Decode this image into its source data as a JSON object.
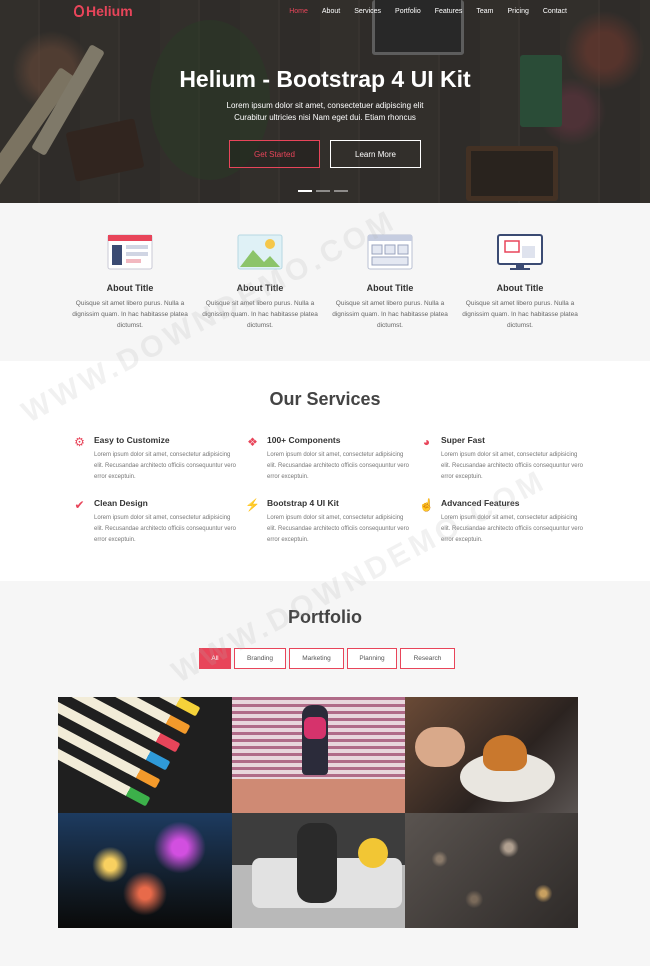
{
  "brand": {
    "name": "Helium",
    "accent": "#e8455a"
  },
  "nav": {
    "items": [
      "Home",
      "About",
      "Services",
      "Portfolio",
      "Features",
      "Team",
      "Pricing",
      "Contact"
    ],
    "active": "Home"
  },
  "hero": {
    "title": "Helium - Bootstrap 4 UI Kit",
    "subtitle": "Lorem ipsum dolor sit amet, consectetuer adipiscing elit Curabitur ultricies nisi Nam eget dui. Etiam rhoncus",
    "primary_button": "Get Started",
    "secondary_button": "Learn More",
    "slides": 3,
    "active_slide": 1
  },
  "features": [
    {
      "icon": "dashboard-icon",
      "title": "About Title",
      "text": "Quisque sit amet libero purus. Nulla a dignissim quam. In hac habitasse platea dictumst."
    },
    {
      "icon": "image-icon",
      "title": "About Title",
      "text": "Quisque sit amet libero purus. Nulla a dignissim quam. In hac habitasse platea dictumst."
    },
    {
      "icon": "layout-icon",
      "title": "About Title",
      "text": "Quisque sit amet libero purus. Nulla a dignissim quam. In hac habitasse platea dictumst."
    },
    {
      "icon": "monitor-icon",
      "title": "About Title",
      "text": "Quisque sit amet libero purus. Nulla a dignissim quam. In hac habitasse platea dictumst."
    }
  ],
  "services": {
    "title": "Our Services",
    "items": [
      {
        "icon": "gears-icon",
        "title": "Easy to Customize",
        "text": "Lorem ipsum dolor sit amet, consectetur adipisicing elit. Recusandae architecto officiis consequuntur vero error exceptuin."
      },
      {
        "icon": "cubes-icon",
        "title": "100+ Components",
        "text": "Lorem ipsum dolor sit amet, consectetur adipisicing elit. Recusandae architecto officiis consequuntur vero error exceptuin."
      },
      {
        "icon": "speedometer-icon",
        "title": "Super Fast",
        "text": "Lorem ipsum dolor sit amet, consectetur adipisicing elit. Recusandae architecto officiis consequuntur vero error exceptuin."
      },
      {
        "icon": "check-icon",
        "title": "Clean Design",
        "text": "Lorem ipsum dolor sit amet, consectetur adipisicing elit. Recusandae architecto officiis consequuntur vero error exceptuin."
      },
      {
        "icon": "bolt-icon",
        "title": "Bootstrap 4 UI Kit",
        "text": "Lorem ipsum dolor sit amet, consectetur adipisicing elit. Recusandae architecto officiis consequuntur vero error exceptuin."
      },
      {
        "icon": "pointer-icon",
        "title": "Advanced Features",
        "text": "Lorem ipsum dolor sit amet, consectetur adipisicing elit. Recusandae architecto officiis consequuntur vero error exceptuin."
      }
    ]
  },
  "portfolio": {
    "title": "Portfolio",
    "filters": [
      "All",
      "Branding",
      "Marketing",
      "Planning",
      "Research"
    ],
    "active_filter": "All"
  },
  "watermark": "WWW.DOWNDEMO.COM"
}
